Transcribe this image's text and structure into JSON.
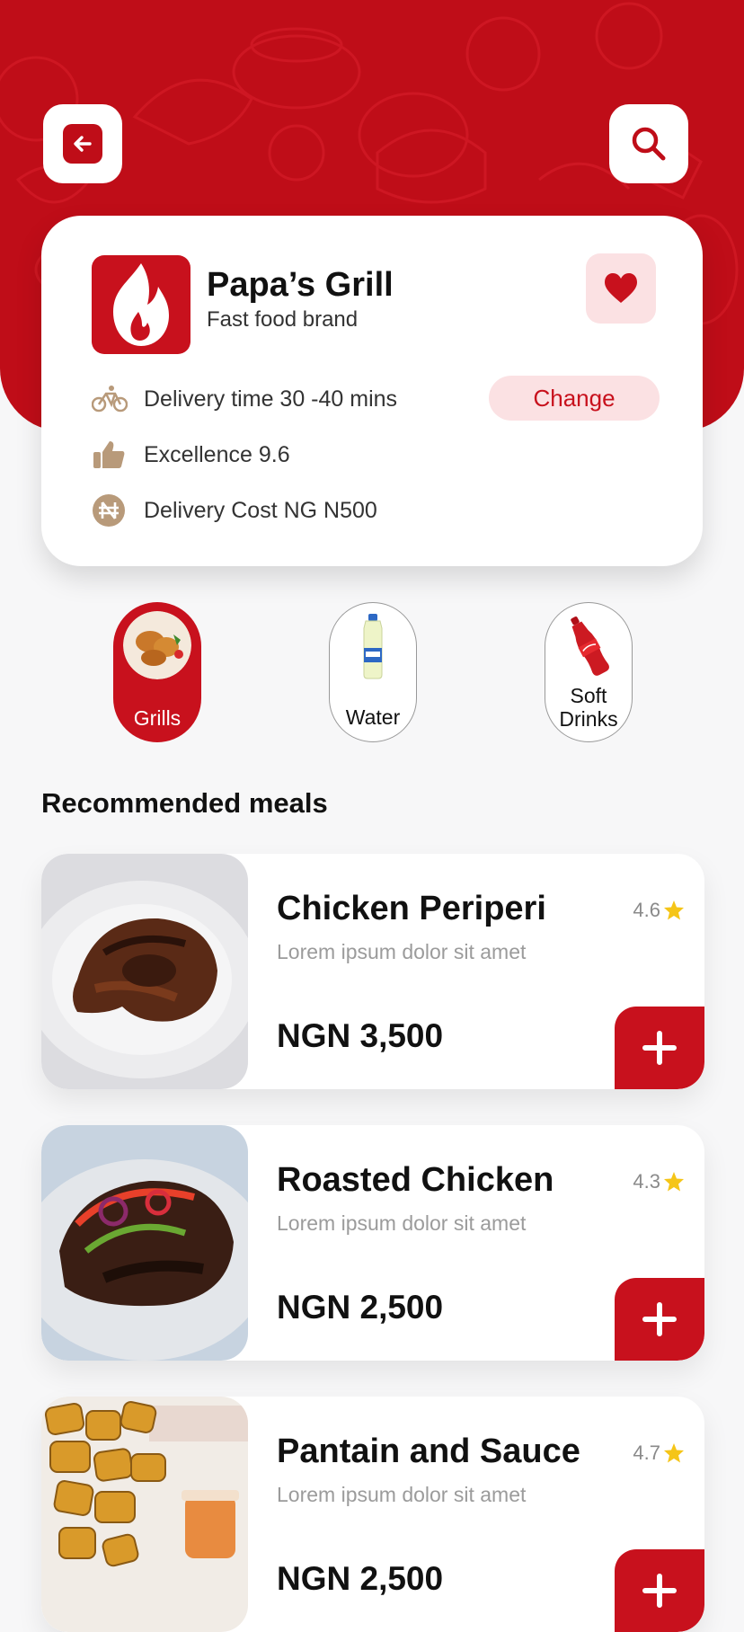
{
  "header": {
    "back_icon": "arrow-left-icon",
    "search_icon": "search-icon",
    "accent_color": "#bf0d18"
  },
  "restaurant": {
    "name": "Papa’s Grill",
    "subtitle": "Fast food brand",
    "logo_icon": "flame-icon",
    "favorite_icon": "heart-icon",
    "delivery_time": "Delivery time 30 -40 mins",
    "change_label": "Change",
    "excellence": "Excellence 9.6",
    "delivery_cost": "Delivery Cost NG N500"
  },
  "categories": [
    {
      "label": "Grills",
      "active": true
    },
    {
      "label": "Water",
      "active": false
    },
    {
      "label": "Soft Drinks",
      "active": false
    }
  ],
  "section_title": "Recommended meals",
  "meals": [
    {
      "name": "Chicken Periperi",
      "description": "Lorem ipsum dolor sit amet",
      "rating": "4.6",
      "price": "NGN 3,500"
    },
    {
      "name": "Roasted Chicken",
      "description": "Lorem ipsum dolor sit amet",
      "rating": "4.3",
      "price": "NGN 2,500"
    },
    {
      "name": "Pantain and Sauce",
      "description": "Lorem ipsum dolor sit amet",
      "rating": "4.7",
      "price": "NGN 2,500"
    }
  ]
}
